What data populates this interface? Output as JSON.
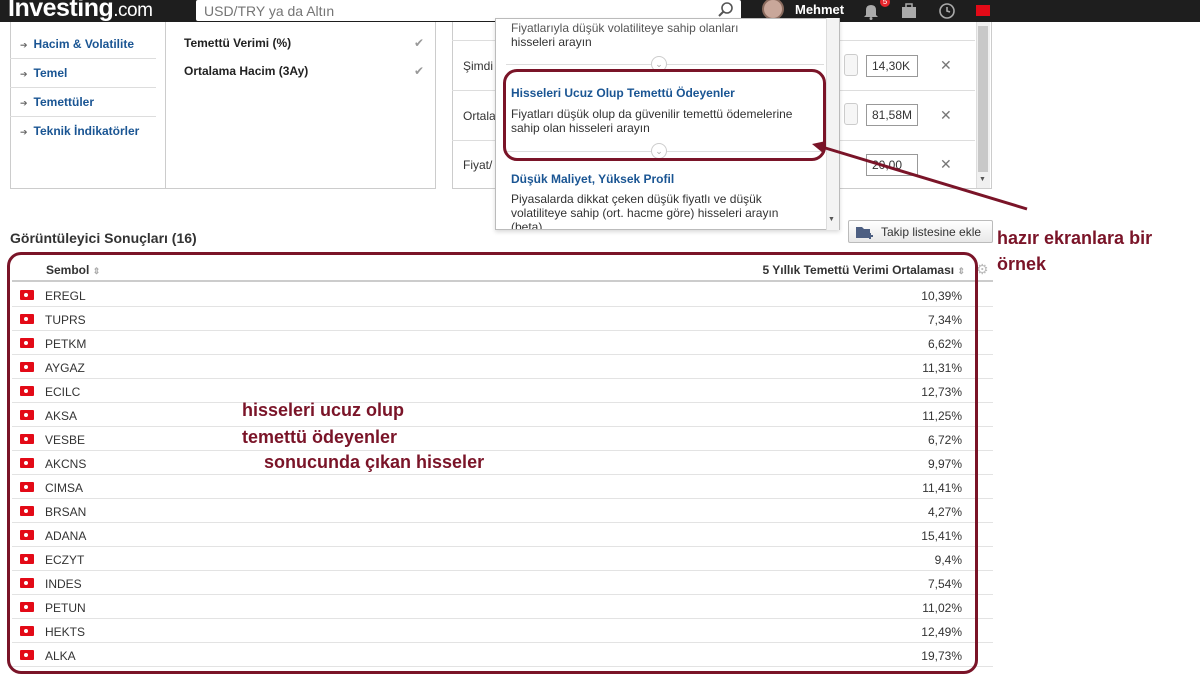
{
  "topbar": {
    "logo_main": "Investing",
    "logo_suffix": ".com",
    "search_placeholder": "USD/TRY ya da Altın",
    "user_name": "Mehmet",
    "notif_count": "5"
  },
  "categories": [
    {
      "label": "Hacim & Volatilite"
    },
    {
      "label": "Temel"
    },
    {
      "label": "Temettüler"
    },
    {
      "label": "Teknik İndikatörler"
    }
  ],
  "criteria_options": [
    {
      "label": "Temettü Verimi (%)",
      "check": "✔"
    },
    {
      "label": "Ortalama Hacim (3Ay)",
      "check": "✔"
    }
  ],
  "criteria_rows": [
    {
      "label": "Şimdi",
      "value": "14,30K"
    },
    {
      "label": "Ortala",
      "value": "81,58M"
    },
    {
      "label": "Fiyat/",
      "value": "20,00"
    }
  ],
  "dropdown": {
    "top_desc_line1": "Fiyatlarıyla düşük volatiliteye sahip olanları",
    "top_desc_line2": "hisseleri arayın",
    "items": [
      {
        "title": "Hisseleri Ucuz Olup Temettü Ödeyenler",
        "desc_line1": "Fiyatları düşük olup da güvenilir temettü ödemelerine",
        "desc_line2": "sahip olan hisseleri arayın"
      },
      {
        "title": "Düşük Maliyet, Yüksek Profil",
        "desc_line1": "Piyasalarda dikkat çeken düşük fiyatlı ve düşük",
        "desc_line2": "volatiliteye sahip (ort. hacme göre) hisseleri arayın",
        "desc_line3": "(beta)"
      }
    ]
  },
  "results": {
    "title": "Görüntüleyici Sonuçları (16)",
    "watchlist_button": "Takip listesine ekle",
    "col_symbol": "Sembol",
    "col_value": "5 Yıllık Temettü Verimi Ortalaması",
    "rows": [
      {
        "symbol": "EREGL",
        "value": "10,39%"
      },
      {
        "symbol": "TUPRS",
        "value": "7,34%"
      },
      {
        "symbol": "PETKM",
        "value": "6,62%"
      },
      {
        "symbol": "AYGAZ",
        "value": "11,31%"
      },
      {
        "symbol": "ECILC",
        "value": "12,73%"
      },
      {
        "symbol": "AKSA",
        "value": "11,25%"
      },
      {
        "symbol": "VESBE",
        "value": "6,72%"
      },
      {
        "symbol": "AKCNS",
        "value": "9,97%"
      },
      {
        "symbol": "CIMSA",
        "value": "11,41%"
      },
      {
        "symbol": "BRSAN",
        "value": "4,27%"
      },
      {
        "symbol": "ADANA",
        "value": "15,41%"
      },
      {
        "symbol": "ECZYT",
        "value": "9,4%"
      },
      {
        "symbol": "INDES",
        "value": "7,54%"
      },
      {
        "symbol": "PETUN",
        "value": "11,02%"
      },
      {
        "symbol": "HEKTS",
        "value": "12,49%"
      },
      {
        "symbol": "ALKA",
        "value": "19,73%"
      }
    ]
  },
  "annotations": {
    "right_line1": "hazır ekranlara bir",
    "right_line2": "örnek",
    "center_line1": "hisseleri ucuz olup",
    "center_line2": "temettü ödeyenler",
    "center_line3": "sonucunda çıkan hisseler"
  },
  "colors": {
    "annotation": "#7a1428",
    "link_blue": "#1a5593",
    "topbar": "#1e1e1e",
    "flag_red": "#e30a17"
  }
}
